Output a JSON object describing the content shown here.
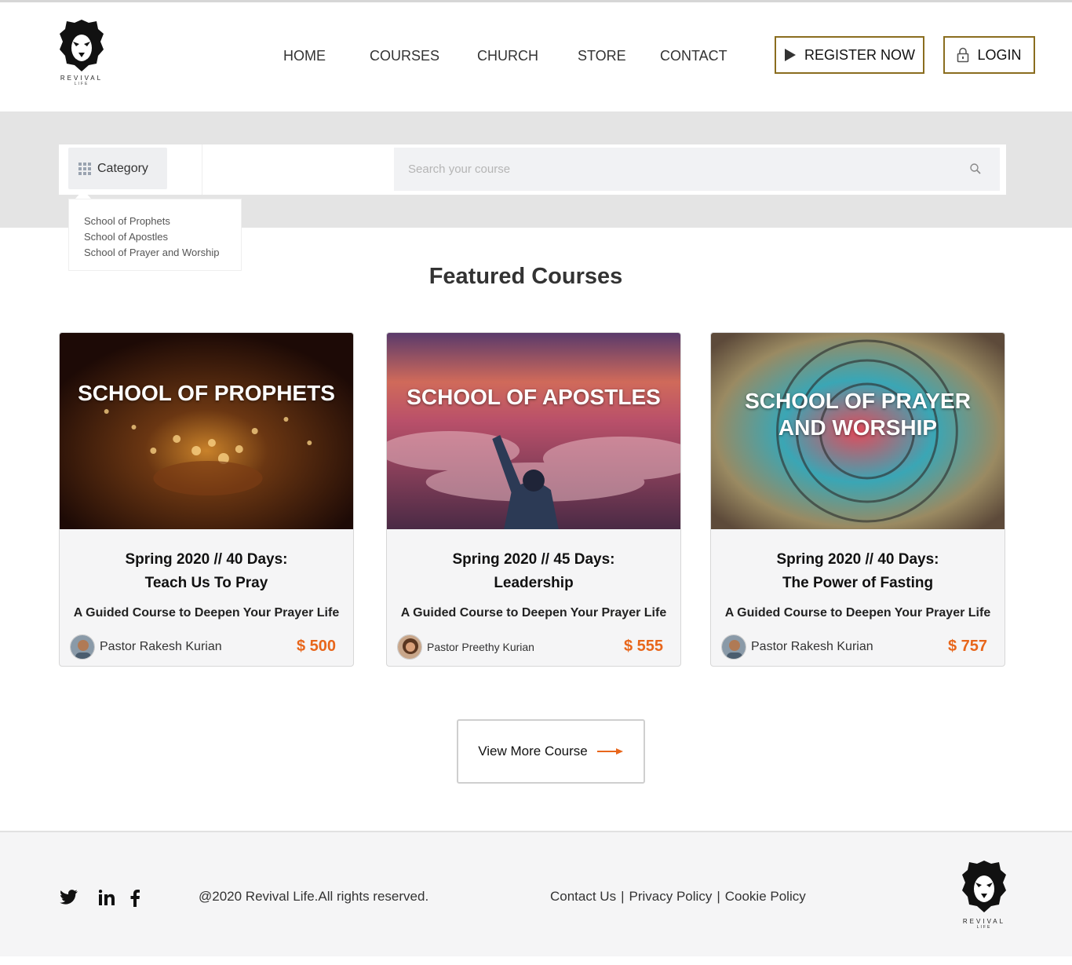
{
  "brand": {
    "wordmark": "REVIVAL",
    "wordmark_sub": "LIFE"
  },
  "nav": [
    {
      "label": "HOME"
    },
    {
      "label": "COURSES"
    },
    {
      "label": "CHURCH"
    },
    {
      "label": "STORE"
    },
    {
      "label": "CONTACT"
    }
  ],
  "header_actions": {
    "register_label": "REGISTER NOW",
    "login_label": "LOGIN"
  },
  "search": {
    "category_label": "Category",
    "placeholder": "Search your course",
    "categories": [
      "School of Prophets",
      "School of Apostles",
      "School of Prayer and Worship"
    ]
  },
  "featured": {
    "title": "Featured Courses",
    "courses": [
      {
        "banner": "SCHOOL OF PROPHETS",
        "title_line1": "Spring 2020 // 40 Days:",
        "title_line2": "Teach Us To Pray",
        "subtitle": "A Guided Course to Deepen Your Prayer Life",
        "author": "Pastor Rakesh Kurian",
        "price": "$ 500"
      },
      {
        "banner": "SCHOOL OF APOSTLES",
        "title_line1": "Spring 2020 // 45 Days:",
        "title_line2": "Leadership",
        "subtitle": "A Guided Course to Deepen Your Prayer Life",
        "author": "Pastor Preethy Kurian",
        "price": "$ 555"
      },
      {
        "banner_line1": "SCHOOL OF PRAYER",
        "banner_line2": "AND WORSHIP",
        "title_line1": "Spring 2020 // 40 Days:",
        "title_line2": "The Power of Fasting",
        "subtitle": "A Guided Course to Deepen Your Prayer Life",
        "author": "Pastor Rakesh Kurian",
        "price": "$ 757"
      }
    ],
    "view_more_label": "View More Course"
  },
  "footer": {
    "copyright": "@2020 Revival Life.All rights reserved.",
    "links": [
      "Contact Us",
      "Privacy Policy",
      "Cookie Policy"
    ],
    "social_icons": [
      "twitter-icon",
      "linkedin-icon",
      "facebook-icon"
    ]
  },
  "colors": {
    "accent_gold": "#8a6d1f",
    "price_orange": "#e8661b"
  }
}
